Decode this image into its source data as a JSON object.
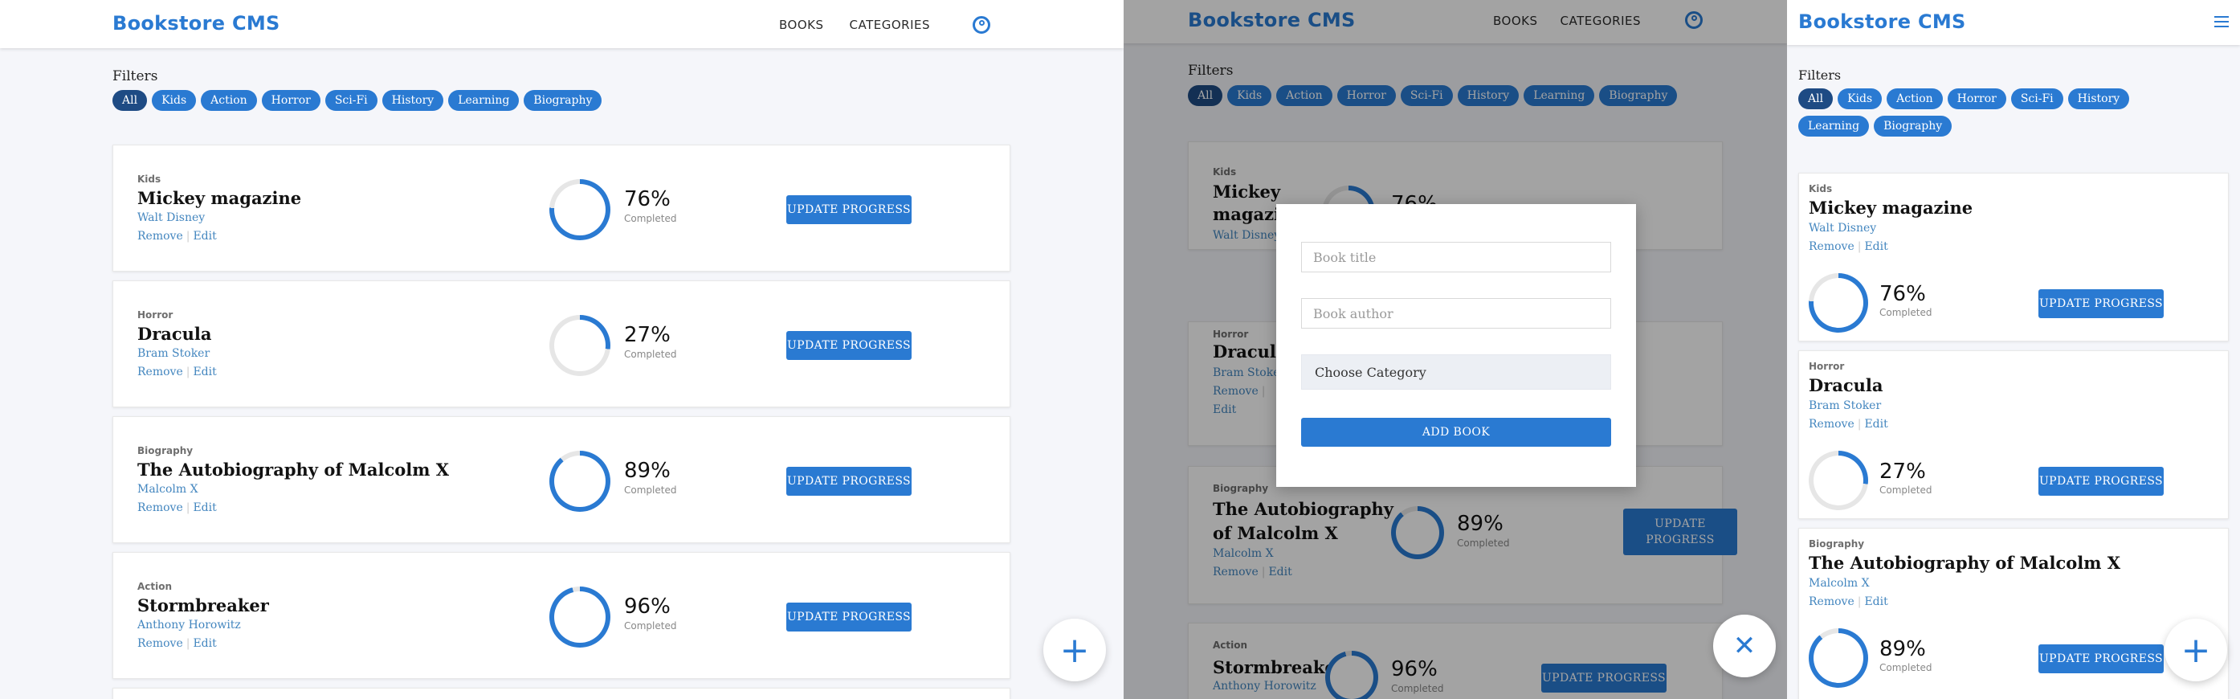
{
  "brand": "Bookstore CMS",
  "nav": {
    "books": "BOOKS",
    "categories": "CATEGORIES"
  },
  "filters": {
    "title": "Filters",
    "chips": [
      "All",
      "Kids",
      "Action",
      "Horror",
      "Sci-Fi",
      "History",
      "Learning",
      "Biography"
    ],
    "active": "All"
  },
  "books": [
    {
      "category": "Kids",
      "title": "Mickey magazine",
      "author": "Walt Disney",
      "progress": 76,
      "progress_label": "76%"
    },
    {
      "category": "Horror",
      "title": "Dracula",
      "author": "Bram Stoker",
      "progress": 27,
      "progress_label": "27%"
    },
    {
      "category": "Biography",
      "title": "The Autobiography of Malcolm X",
      "author": "Malcolm X",
      "progress": 89,
      "progress_label": "89%"
    },
    {
      "category": "Action",
      "title": "Stormbreaker",
      "author": "Anthony Horowitz",
      "progress": 96,
      "progress_label": "96%"
    }
  ],
  "card_text": {
    "remove": "Remove",
    "edit": "Edit",
    "completed": "Completed",
    "update": "UPDATE PROGRESS",
    "update_line1": "UPDATE",
    "update_line2": "PROGRESS"
  },
  "form": {
    "title_placeholder": "Book title",
    "author_placeholder": "Book author",
    "category_select": "Choose Category",
    "submit": "ADD BOOK"
  },
  "fab": {
    "add": "+",
    "close": "✕"
  },
  "colors": {
    "accent": "#2a7ad2",
    "active_chip": "#1e4b84",
    "ring_track": "#e6e6e6",
    "page_bg": "#f5f6fa"
  },
  "icons": [
    "user-icon",
    "add-icon",
    "close-icon",
    "menu-icon"
  ]
}
